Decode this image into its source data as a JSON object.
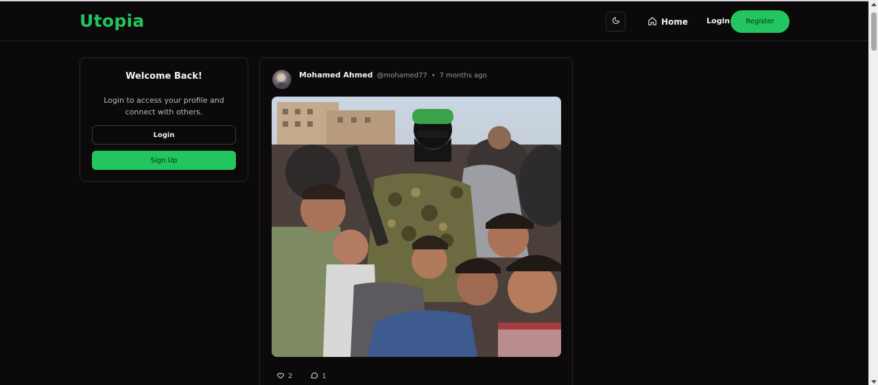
{
  "nav": {
    "logo": "Utopia",
    "home_label": "Home",
    "login_label": "Login",
    "register_label": "Register",
    "theme_icon": "moon-icon",
    "home_icon": "house-icon"
  },
  "welcome": {
    "title": "Welcome Back!",
    "text": "Login to access your profile and connect with others.",
    "login_label": "Login",
    "signup_label": "Sign Up"
  },
  "post": {
    "author_name": "Mohamed Ahmed",
    "author_handle": "@mohamed77",
    "separator": "•",
    "time": "7 months ago",
    "likes": "2",
    "comments": "1",
    "like_icon": "heart-icon",
    "comment_icon": "comment-icon"
  },
  "colors": {
    "accent": "#22c55e",
    "background": "#0b0909",
    "card_border": "#2a2727"
  }
}
